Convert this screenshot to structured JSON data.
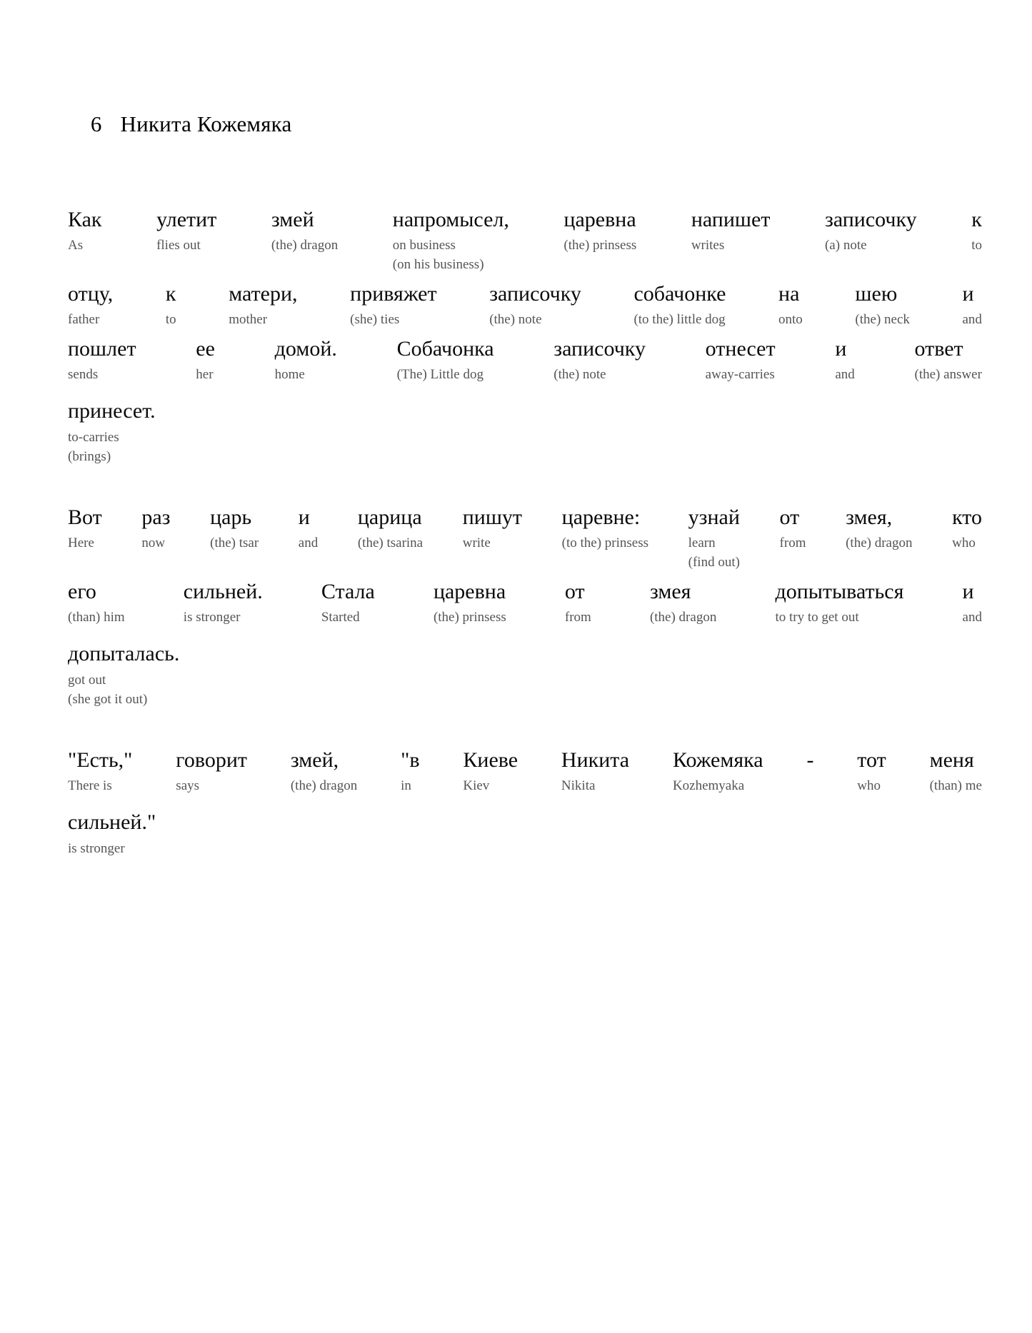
{
  "heading": {
    "number": "6",
    "title": "Никита Кожемяка"
  },
  "paragraphs": [
    {
      "id": "paragraph-1",
      "lines": [
        {
          "layout": "justify",
          "cells": [
            {
              "ru": "Как",
              "en": "As",
              "en2": ""
            },
            {
              "ru": "улетит",
              "en": "flies out",
              "en2": ""
            },
            {
              "ru": "змей",
              "en": "(the) dragon",
              "en2": ""
            },
            {
              "ru": "напромысел,",
              "en": "on business",
              "en2": "(on his business)"
            },
            {
              "ru": "царевна",
              "en": "(the) prinsess",
              "en2": ""
            },
            {
              "ru": "напишет",
              "en": "writes",
              "en2": ""
            },
            {
              "ru": "записочку",
              "en": "(a) note",
              "en2": ""
            },
            {
              "ru": "к",
              "en": "to",
              "en2": ""
            }
          ]
        },
        {
          "layout": "justify",
          "cells": [
            {
              "ru": "отцу,",
              "en": "father",
              "en2": ""
            },
            {
              "ru": "к",
              "en": "to",
              "en2": ""
            },
            {
              "ru": "матери,",
              "en": "mother",
              "en2": ""
            },
            {
              "ru": "привяжет",
              "en": "(she) ties",
              "en2": ""
            },
            {
              "ru": "записочку",
              "en": "(the) note",
              "en2": ""
            },
            {
              "ru": "собачонке",
              "en": "(to the) little dog",
              "en2": ""
            },
            {
              "ru": "на",
              "en": "onto",
              "en2": ""
            },
            {
              "ru": "шею",
              "en": "(the) neck",
              "en2": ""
            },
            {
              "ru": "и",
              "en": "and",
              "en2": ""
            }
          ]
        },
        {
          "layout": "justify",
          "cells": [
            {
              "ru": "пошлет",
              "en": "sends",
              "en2": ""
            },
            {
              "ru": "ее",
              "en": "her",
              "en2": ""
            },
            {
              "ru": "домой.",
              "en": "home",
              "en2": ""
            },
            {
              "ru": "Собачонка",
              "en": "(The) Little dog",
              "en2": ""
            },
            {
              "ru": "записочку",
              "en": "(the) note",
              "en2": ""
            },
            {
              "ru": "отнесет",
              "en": "away-carries",
              "en2": ""
            },
            {
              "ru": "и",
              "en": "and",
              "en2": ""
            },
            {
              "ru": "ответ",
              "en": "(the) answer",
              "en2": ""
            }
          ]
        },
        {
          "layout": "flow",
          "cells": [
            {
              "ru": "принесет.",
              "en": "to-carries",
              "en2": "(brings)"
            }
          ]
        }
      ]
    },
    {
      "id": "paragraph-2",
      "lines": [
        {
          "layout": "justify",
          "cells": [
            {
              "ru": "Вот",
              "en": "Here",
              "en2": ""
            },
            {
              "ru": "раз",
              "en": "now",
              "en2": ""
            },
            {
              "ru": "царь",
              "en": "(the) tsar",
              "en2": ""
            },
            {
              "ru": "и",
              "en": "and",
              "en2": ""
            },
            {
              "ru": "царица",
              "en": "(the) tsarina",
              "en2": ""
            },
            {
              "ru": "пишут",
              "en": "write",
              "en2": ""
            },
            {
              "ru": "царевне:",
              "en": "(to the) prinsess",
              "en2": ""
            },
            {
              "ru": "узнай",
              "en": "learn",
              "en2": "(find out)"
            },
            {
              "ru": "от",
              "en": "from",
              "en2": ""
            },
            {
              "ru": "змея,",
              "en": "(the) dragon",
              "en2": ""
            },
            {
              "ru": "кто",
              "en": "who",
              "en2": ""
            }
          ]
        },
        {
          "layout": "justify",
          "cells": [
            {
              "ru": "его",
              "en": "(than) him",
              "en2": ""
            },
            {
              "ru": "сильней.",
              "en": "is stronger",
              "en2": ""
            },
            {
              "ru": "Стала",
              "en": "Started",
              "en2": ""
            },
            {
              "ru": "царевна",
              "en": "(the) prinsess",
              "en2": ""
            },
            {
              "ru": "от",
              "en": "from",
              "en2": ""
            },
            {
              "ru": "змея",
              "en": "(the) dragon",
              "en2": ""
            },
            {
              "ru": "допытываться",
              "en": "to try to get out",
              "en2": ""
            },
            {
              "ru": "и",
              "en": "and",
              "en2": ""
            }
          ]
        },
        {
          "layout": "flow",
          "cells": [
            {
              "ru": "допыталась.",
              "en": "got out",
              "en2": "(she got it out)"
            }
          ]
        }
      ]
    },
    {
      "id": "paragraph-3",
      "lines": [
        {
          "layout": "justify",
          "cells": [
            {
              "ru": "\"Есть,\"",
              "en": "There is",
              "en2": ""
            },
            {
              "ru": "говорит",
              "en": "says",
              "en2": ""
            },
            {
              "ru": "змей,",
              "en": "(the) dragon",
              "en2": ""
            },
            {
              "ru": "\"в",
              "en": "in",
              "en2": ""
            },
            {
              "ru": "Киеве",
              "en": "Kiev",
              "en2": ""
            },
            {
              "ru": "Никита",
              "en": "Nikita",
              "en2": ""
            },
            {
              "ru": "Кожемяка",
              "en": "Kozhemyaka",
              "en2": ""
            },
            {
              "ru": "-",
              "en": "",
              "en2": ""
            },
            {
              "ru": "тот",
              "en": "who",
              "en2": ""
            },
            {
              "ru": "меня",
              "en": "(than) me",
              "en2": ""
            }
          ]
        },
        {
          "layout": "flow",
          "cells": [
            {
              "ru": "сильней.\"",
              "en": "is stronger",
              "en2": ""
            }
          ]
        }
      ]
    }
  ]
}
